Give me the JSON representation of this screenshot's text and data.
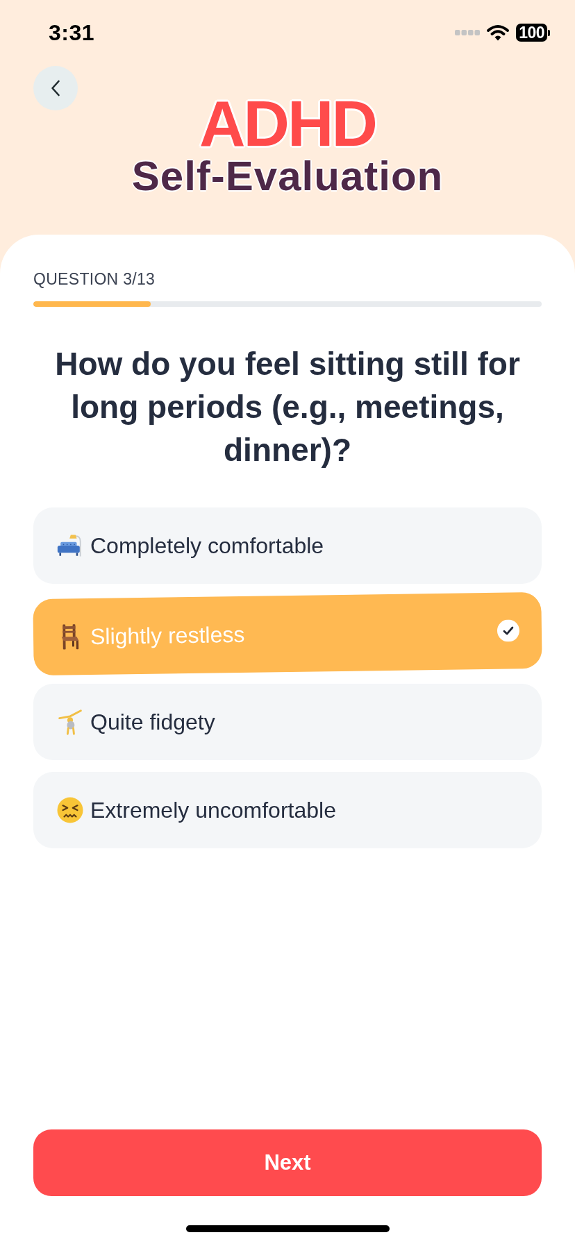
{
  "status_bar": {
    "time": "3:31",
    "battery": "100"
  },
  "header": {
    "title": "ADHD",
    "subtitle": "Self-Evaluation"
  },
  "progress": {
    "label": "QUESTION 3/13",
    "level": 0.231
  },
  "question": "How do you feel sitting still for long periods (e.g., meetings, dinner)?",
  "options": [
    {
      "label": "Completely comfortable",
      "selected": false
    },
    {
      "label": "Slightly restless",
      "selected": true
    },
    {
      "label": "Quite fidgety",
      "selected": false
    },
    {
      "label": "Extremely uncomfortable",
      "selected": false
    }
  ],
  "next_button": "Next"
}
